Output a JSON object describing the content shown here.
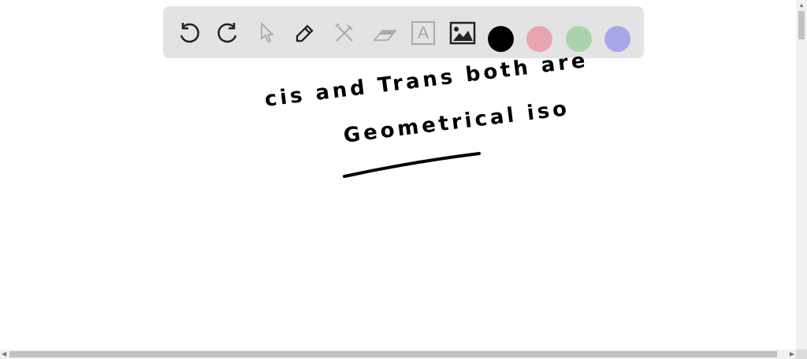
{
  "toolbar": {
    "tools": [
      "undo-icon",
      "redo-icon",
      "pointer-icon",
      "pencil-icon",
      "tools-icon",
      "eraser-icon",
      "text-icon",
      "image-icon"
    ],
    "text_tool_glyph": "A",
    "colors": [
      "#000000",
      "#e8a5ad",
      "#a9d4ab",
      "#aaa6ea"
    ]
  },
  "canvas": {
    "line1": "cis and Trans both are",
    "line2": "Geometrical iso"
  }
}
